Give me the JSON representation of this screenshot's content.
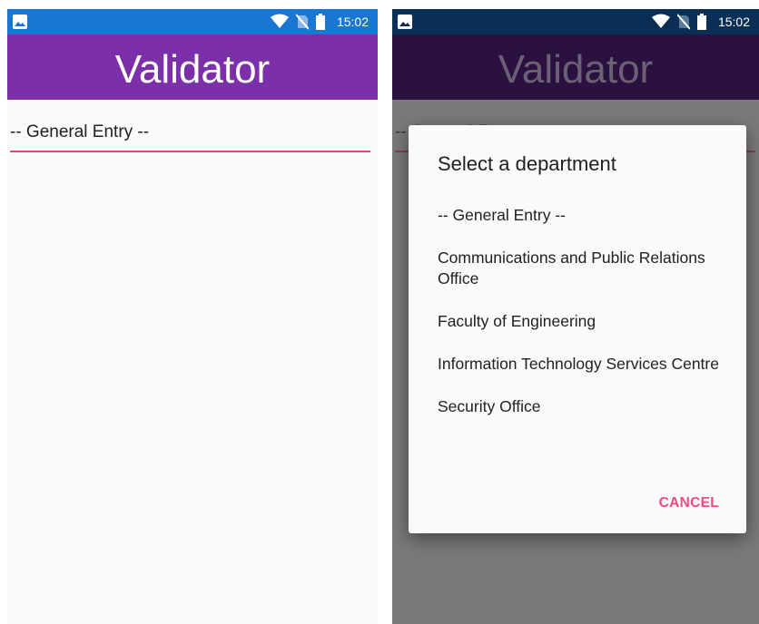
{
  "status_bar": {
    "time": "15:02",
    "icons": [
      "image-icon",
      "wifi-icon",
      "no-sim-icon",
      "battery-icon"
    ]
  },
  "app": {
    "title": "Validator"
  },
  "spinner": {
    "selected": "-- General Entry  --"
  },
  "dialog": {
    "title": "Select a department",
    "options": [
      "-- General Entry  --",
      "Communications and Public Relations Office",
      "Faculty of Engineering",
      "Information Technology Services Centre",
      "Security Office"
    ],
    "cancel": "CANCEL"
  },
  "colors": {
    "status_bar": "#1976d2",
    "app_bar": "#7b2fa8",
    "accent": "#e8457a",
    "button": "#ee4a85"
  }
}
